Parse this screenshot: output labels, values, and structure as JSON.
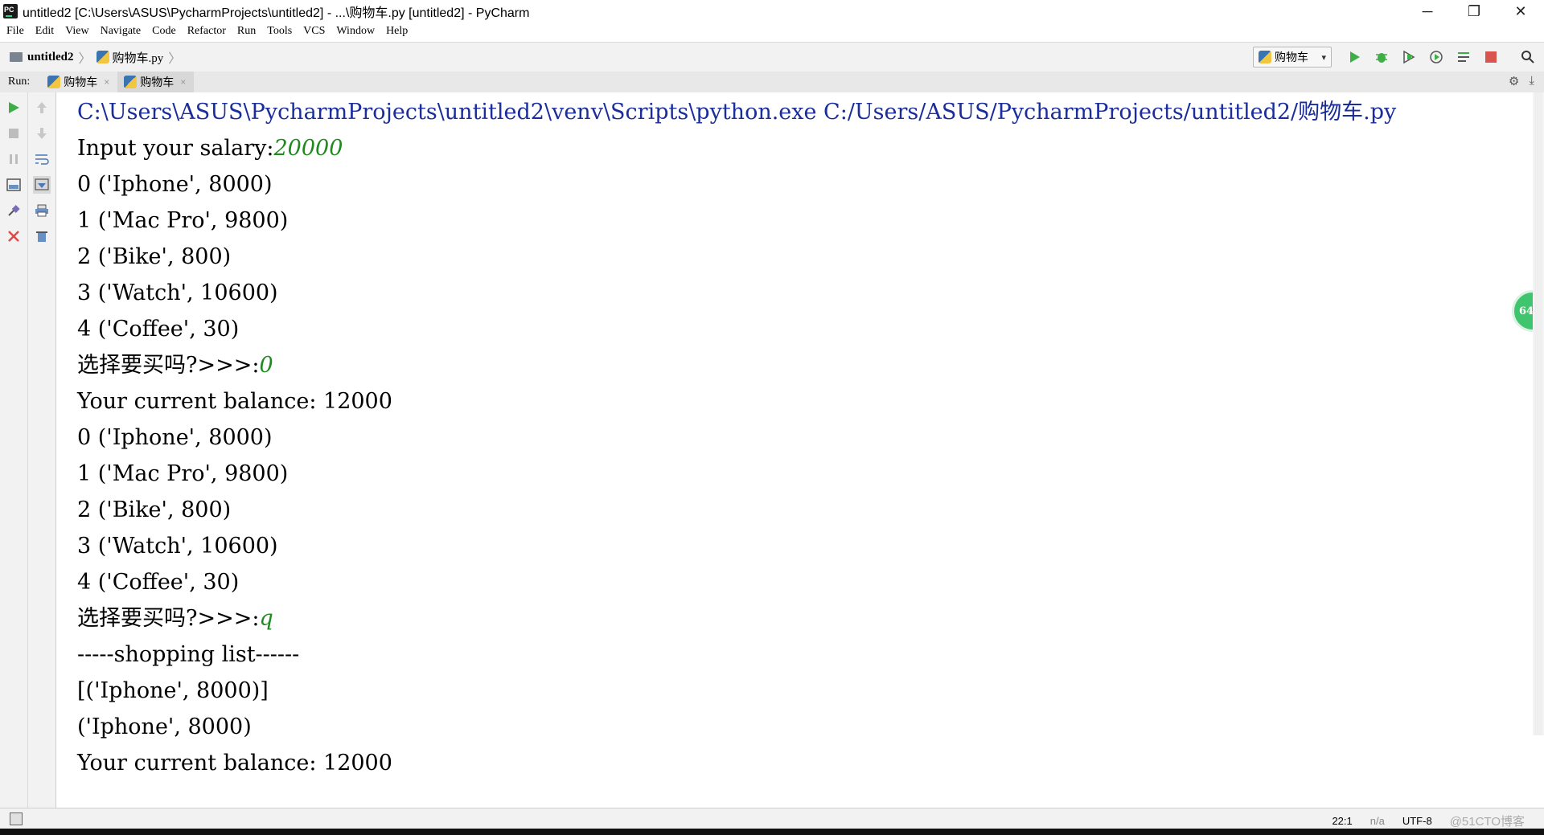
{
  "window": {
    "title": "untitled2 [C:\\Users\\ASUS\\PycharmProjects\\untitled2] - ...\\购物车.py [untitled2] - PyCharm",
    "controls": [
      "─",
      "❐",
      "✕"
    ]
  },
  "menu": [
    "File",
    "Edit",
    "View",
    "Navigate",
    "Code",
    "Refactor",
    "Run",
    "Tools",
    "VCS",
    "Window",
    "Help"
  ],
  "breadcrumb": {
    "project": "untitled2",
    "file": "购物车.py"
  },
  "toolbar": {
    "run_config": "购物车",
    "icons": [
      "run-icon",
      "debug-icon",
      "coverage-icon",
      "profile-icon",
      "build-icon",
      "stop-icon",
      "search-icon"
    ]
  },
  "run_panel": {
    "label": "Run:",
    "tabs": [
      {
        "label": "购物车",
        "close": "×"
      },
      {
        "label": "购物车",
        "close": "×"
      }
    ]
  },
  "console": {
    "command": "C:\\Users\\ASUS\\PycharmProjects\\untitled2\\venv\\Scripts\\python.exe C:/Users/ASUS/PycharmProjects/untitled2/购物车.py",
    "lines": [
      {
        "text": "Input your salary:",
        "input": "20000"
      },
      {
        "text": "0 ('Iphone', 8000)"
      },
      {
        "text": "1 ('Mac Pro', 9800)"
      },
      {
        "text": "2 ('Bike', 800)"
      },
      {
        "text": "3 ('Watch', 10600)"
      },
      {
        "text": "4 ('Coffee', 30)"
      },
      {
        "text": "选择要买吗?>>>:",
        "input": "0"
      },
      {
        "text": "Your current balance: 12000"
      },
      {
        "text": "0 ('Iphone', 8000)"
      },
      {
        "text": "1 ('Mac Pro', 9800)"
      },
      {
        "text": "2 ('Bike', 800)"
      },
      {
        "text": "3 ('Watch', 10600)"
      },
      {
        "text": "4 ('Coffee', 30)"
      },
      {
        "text": "选择要买吗?>>>:",
        "input": "q"
      },
      {
        "text": "-----shopping list------"
      },
      {
        "text": "[('Iphone', 8000)]"
      },
      {
        "text": "('Iphone', 8000)"
      },
      {
        "text": "Your current balance: 12000"
      }
    ]
  },
  "side_badge": "64",
  "status": {
    "position": "22:1",
    "line_sep": "n/a",
    "encoding": "UTF-8",
    "watermark": "@51CTO博客"
  },
  "colors": {
    "command": "#1a2d9a",
    "user_input": "#1f8a1f",
    "run_green": "#3fae47",
    "stop_red": "#d9534f"
  }
}
